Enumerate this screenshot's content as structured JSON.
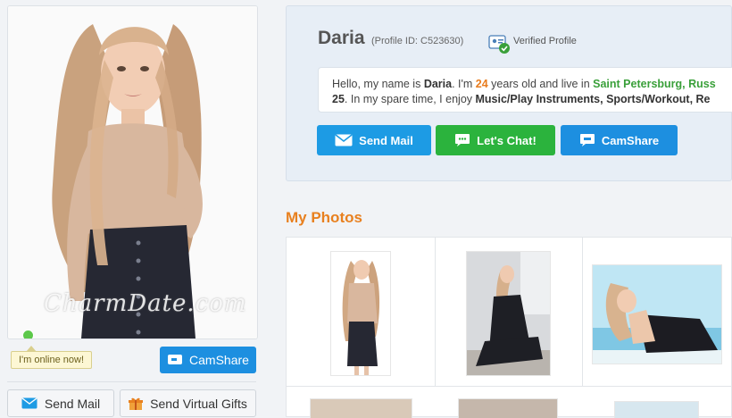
{
  "profile": {
    "name": "Daria",
    "id_text": "(Profile ID: C523630)",
    "verified_label": "Verified Profile",
    "watermark": "CharmDate.com",
    "online_status": "I'm online now!",
    "intro": {
      "p1": "Hello, my name is ",
      "name": "Daria",
      "p2": ". I'm ",
      "age": "24",
      "p3": " years old and live in ",
      "city": "Saint Petersburg, Russ",
      "line2_age": "25",
      "line2_p1": ". In my spare time, I enjoy ",
      "interests": "Music/Play Instruments, Sports/Workout, Re"
    }
  },
  "buttons": {
    "send_mail": "Send Mail",
    "lets_chat": "Let's Chat!",
    "camshare": "CamShare",
    "send_virtual_gifts": "Send Virtual Gifts"
  },
  "photos": {
    "title": "My Photos"
  },
  "colors": {
    "blue": "#1d9be4",
    "green": "#2bb33d",
    "orange": "#e8801f",
    "online": "#5cc84a"
  }
}
